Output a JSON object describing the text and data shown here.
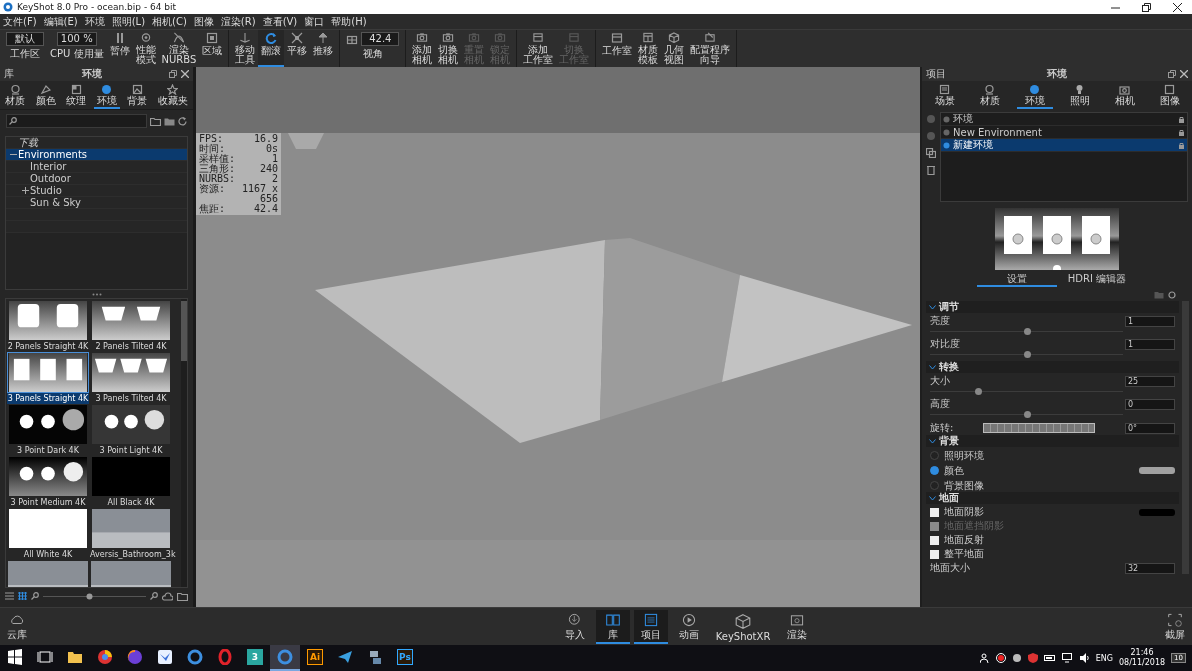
{
  "window": {
    "title": "KeyShot 8.0 Pro  - ocean.bip  - 64 bit"
  },
  "menu": [
    "文件(F)",
    "编辑(E)",
    "环境",
    "照明(L)",
    "相机(C)",
    "图像",
    "渲染(R)",
    "查看(V)",
    "窗口",
    "帮助(H)"
  ],
  "toolbar": [
    [
      {
        "kind": "dropdown",
        "value": "默认",
        "label": "工作区"
      },
      {
        "kind": "field",
        "value": "100 %",
        "label": "CPU 使用量"
      },
      {
        "kind": "button",
        "lines": [
          "暂停"
        ],
        "selected": false,
        "disabled": false
      },
      {
        "kind": "button",
        "lines": [
          "性能",
          "模式"
        ],
        "selected": false,
        "disabled": false
      },
      {
        "kind": "button",
        "lines": [
          "渲染",
          "NURBS"
        ],
        "selected": false,
        "disabled": false
      },
      {
        "kind": "button",
        "lines": [
          "区域"
        ],
        "selected": false,
        "disabled": false
      }
    ],
    [
      {
        "kind": "button",
        "lines": [
          "移动",
          "工具"
        ],
        "selected": false,
        "disabled": false
      },
      {
        "kind": "button",
        "lines": [
          "翻滚"
        ],
        "selected": true,
        "disabled": false
      },
      {
        "kind": "button",
        "lines": [
          "平移"
        ],
        "selected": false,
        "disabled": false
      },
      {
        "kind": "button",
        "lines": [
          "推移"
        ],
        "selected": false,
        "disabled": false
      }
    ],
    [
      {
        "kind": "field",
        "value": "42.4",
        "label": "视角"
      }
    ],
    [
      {
        "kind": "button",
        "lines": [
          "添加",
          "相机"
        ],
        "selected": false,
        "disabled": false
      },
      {
        "kind": "button",
        "lines": [
          "切换",
          "相机"
        ],
        "selected": false,
        "disabled": false
      },
      {
        "kind": "button",
        "lines": [
          "重置",
          "相机"
        ],
        "selected": false,
        "disabled": true
      },
      {
        "kind": "button",
        "lines": [
          "锁定",
          "相机"
        ],
        "selected": false,
        "disabled": true
      }
    ],
    [
      {
        "kind": "button",
        "lines": [
          "添加",
          "工作室"
        ],
        "selected": false,
        "disabled": false
      },
      {
        "kind": "button",
        "lines": [
          "切换",
          "工作室"
        ],
        "selected": false,
        "disabled": true
      }
    ],
    [
      {
        "kind": "button",
        "lines": [
          "工作室"
        ],
        "selected": false,
        "disabled": false
      },
      {
        "kind": "button",
        "lines": [
          "材质",
          "模板"
        ],
        "selected": false,
        "disabled": false
      },
      {
        "kind": "button",
        "lines": [
          "几何",
          "视图"
        ],
        "selected": false,
        "disabled": false
      },
      {
        "kind": "button",
        "lines": [
          "配置程序",
          "向导"
        ],
        "selected": false,
        "disabled": false
      }
    ]
  ],
  "library": {
    "panel_label": "库",
    "title": "环境",
    "tabs": [
      {
        "label": "材质",
        "selected": false
      },
      {
        "label": "颜色",
        "selected": false
      },
      {
        "label": "纹理",
        "selected": false
      },
      {
        "label": "环境",
        "selected": true
      },
      {
        "label": "背景",
        "selected": false
      },
      {
        "label": "收藏夹",
        "selected": false
      }
    ],
    "tree": [
      {
        "label": "下载",
        "selected": false
      },
      {
        "label": "Environments",
        "selected": true,
        "expanded": true,
        "children": [
          {
            "label": "Interior",
            "selected": false
          },
          {
            "label": "Outdoor",
            "selected": false
          },
          {
            "label": "Studio",
            "selected": false,
            "expanded": false
          },
          {
            "label": "Sun & Sky",
            "selected": false
          }
        ]
      }
    ],
    "thumbnails": [
      {
        "name": "2 Panels Straight 4K",
        "kind": "panels2",
        "selected": false
      },
      {
        "name": "2 Panels Tilted 4K",
        "kind": "tilted2",
        "selected": false
      },
      {
        "name": "3 Panels Straight 4K",
        "kind": "panels3",
        "selected": true
      },
      {
        "name": "3 Panels Tilted 4K",
        "kind": "tilted3",
        "selected": false
      },
      {
        "name": "3 Point Dark 4K",
        "kind": "dots-dark",
        "selected": false
      },
      {
        "name": "3 Point Light 4K",
        "kind": "dots-light",
        "selected": false
      },
      {
        "name": "3 Point Medium 4K",
        "kind": "dots-medium",
        "selected": false
      },
      {
        "name": "All Black 4K",
        "kind": "black",
        "selected": false
      },
      {
        "name": "All White 4K",
        "kind": "white",
        "selected": false
      },
      {
        "name": "Aversis_Bathroom_3k",
        "kind": "photo",
        "selected": false
      },
      {
        "kind": "photo",
        "selected": false
      },
      {
        "kind": "photo",
        "selected": false
      }
    ],
    "zoom_slider": {
      "level": 0.45
    }
  },
  "viewport": {
    "stats": [
      {
        "label": "FPS:",
        "value": "16.9"
      },
      {
        "label": "时间:",
        "value": "0s"
      },
      {
        "label": "采样值:",
        "value": "1"
      },
      {
        "label": "三角形:",
        "value": "240"
      },
      {
        "label": "NURBS:",
        "value": "2"
      },
      {
        "label": "资源:",
        "value": "1167 x 656"
      },
      {
        "label": "焦距:",
        "value": "42.4"
      }
    ]
  },
  "project": {
    "panel_label": "项目",
    "title": "环境",
    "tabs": [
      {
        "label": "场景",
        "selected": false
      },
      {
        "label": "材质",
        "selected": false
      },
      {
        "label": "环境",
        "selected": true
      },
      {
        "label": "照明",
        "selected": false
      },
      {
        "label": "相机",
        "selected": false
      },
      {
        "label": "图像",
        "selected": false
      }
    ],
    "environments": [
      {
        "label": "环境",
        "selected": false
      },
      {
        "label": "New Environment",
        "selected": false
      },
      {
        "label": "新建环境",
        "selected": true
      }
    ],
    "subtabs": [
      {
        "label": "设置",
        "selected": true
      },
      {
        "label": "HDRI 编辑器",
        "selected": false
      }
    ],
    "sections": [
      {
        "title": "调节",
        "expanded": true,
        "rows": [
          {
            "kind": "slider",
            "label": "亮度",
            "value": "1",
            "level": 0.5
          },
          {
            "kind": "slider",
            "label": "对比度",
            "value": "1",
            "level": 0.5
          }
        ]
      },
      {
        "title": "转换",
        "expanded": true,
        "rows": [
          {
            "kind": "slider",
            "label": "大小",
            "value": "25",
            "level": 0.25
          },
          {
            "kind": "slider",
            "label": "高度",
            "value": "0",
            "level": 0.5
          },
          {
            "kind": "dial",
            "label": "旋转:",
            "value": "0°"
          }
        ]
      },
      {
        "title": "背景",
        "expanded": true,
        "rows": [
          {
            "kind": "radio",
            "label": "照明环境",
            "selected": false
          },
          {
            "kind": "radio",
            "label": "颜色",
            "selected": true,
            "color": "#a0a0a0"
          },
          {
            "kind": "radio",
            "label": "背景图像",
            "selected": false
          }
        ]
      },
      {
        "title": "地面",
        "expanded": true,
        "rows": [
          {
            "kind": "checkbox",
            "label": "地面阴影",
            "checked": false,
            "disabled": false,
            "color": "#000000"
          },
          {
            "kind": "checkbox",
            "label": "地面遮挡阴影",
            "checked": false,
            "disabled": true
          },
          {
            "kind": "checkbox",
            "label": "地面反射",
            "checked": false,
            "disabled": false
          },
          {
            "kind": "checkbox",
            "label": "整平地面",
            "checked": false,
            "disabled": false
          },
          {
            "kind": "number",
            "label": "地面大小",
            "value": "32"
          }
        ]
      }
    ]
  },
  "dock": {
    "left": {
      "label": "云库"
    },
    "items": [
      {
        "label": "导入",
        "selected": false
      },
      {
        "label": "库",
        "selected": true
      },
      {
        "label": "项目",
        "selected": true
      },
      {
        "label": "动画",
        "selected": false
      },
      {
        "label": "KeyShotXR",
        "selected": false
      },
      {
        "label": "渲染",
        "selected": false
      }
    ],
    "right": {
      "label": "截屏"
    }
  },
  "taskbar": {
    "apps": [
      {
        "kind": "start"
      },
      {
        "kind": "taskview"
      },
      {
        "kind": "folder",
        "selected": false
      },
      {
        "kind": "round",
        "selected": false
      },
      {
        "kind": "fox",
        "selected": false
      },
      {
        "kind": "bird",
        "selected": false
      },
      {
        "kind": "ring",
        "selected": false
      },
      {
        "kind": "o",
        "selected": false
      },
      {
        "kind": "letter",
        "label": "3",
        "selected": false
      },
      {
        "kind": "ring",
        "selected": true
      },
      {
        "kind": "letter",
        "label": "Ai",
        "selected": false
      },
      {
        "kind": "plane",
        "selected": false
      },
      {
        "kind": "network",
        "selected": false
      },
      {
        "kind": "letter",
        "label": "Ps",
        "selected": false
      }
    ],
    "language": "ENG",
    "time": "21:46",
    "date": "08/11/2018",
    "notifications": "10"
  }
}
